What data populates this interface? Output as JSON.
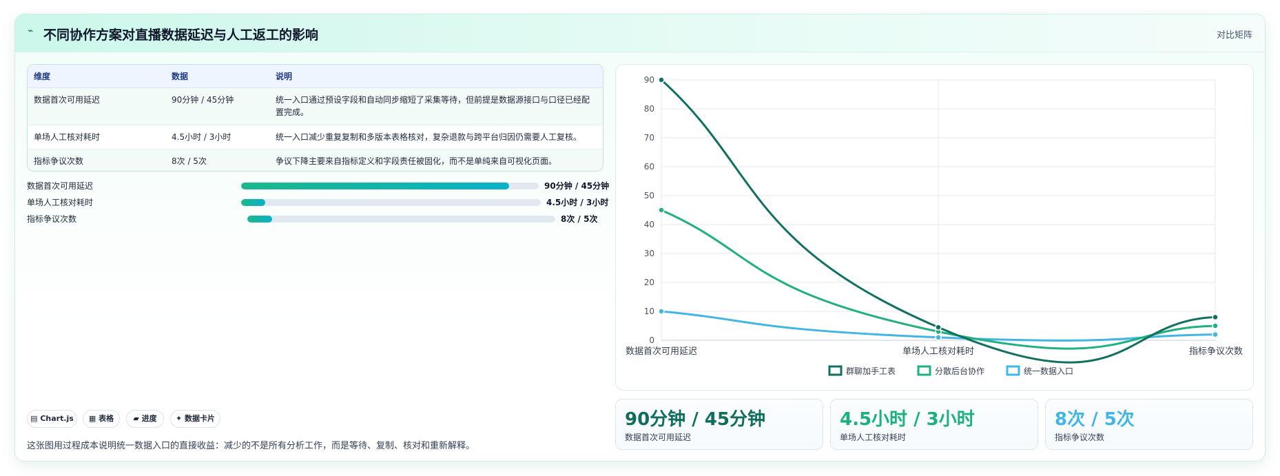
{
  "header": {
    "title": "不同协作方案对直播数据延迟与人工返工的影响",
    "view_tag": "对比矩阵",
    "icon": "sparkline-icon"
  },
  "table": {
    "columns": [
      "维度",
      "数据",
      "说明"
    ],
    "rows": [
      [
        "数据首次可用延迟",
        "90分钟 / 45分钟",
        "统一入口通过预设字段和自动同步缩短了采集等待，但前提是数据源接口与口径已经配置完成。"
      ],
      [
        "单场人工核对耗时",
        "4.5小时 / 3小时",
        "统一入口减少重复复制和多版本表格核对，复杂退款与跨平台归因仍需要人工复核。"
      ],
      [
        "指标争议次数",
        "8次 / 5次",
        "争议下降主要来自指标定义和字段责任被固化，而不是单纯来自可视化页面。"
      ]
    ]
  },
  "progress": [
    {
      "label": "数据首次可用延迟",
      "value_text": "90分钟 / 45分钟",
      "fraction": 0.9
    },
    {
      "label": "单场人工核对耗时",
      "value_text": "4.5小时 / 3小时",
      "fraction": 0.08
    },
    {
      "label": "指标争议次数",
      "value_text": "8次 / 5次",
      "fraction": 0.08
    }
  ],
  "chips": [
    "▤ Chart.js",
    "▦ 表格",
    "▰ 进度",
    "✦ 数据卡片"
  ],
  "summary": "这张图用过程成本说明统一数据入口的直接收益：减少的不是所有分析工作，而是等待、复制、核对和重新解释。",
  "stats": [
    {
      "value": "90分钟 / 45分钟",
      "label": "数据首次可用延迟",
      "color": "#0f6e5c"
    },
    {
      "value": "4.5小时 / 3小时",
      "label": "单场人工核对耗时",
      "color": "#1bb07d"
    },
    {
      "value": "8次 / 5次",
      "label": "指标争议次数",
      "color": "#41b6e6"
    }
  ],
  "chart_data": {
    "type": "line",
    "categories": [
      "数据首次可用延迟",
      "单场人工核对耗时",
      "指标争议次数"
    ],
    "series": [
      {
        "name": "群聊加手工表",
        "values": [
          90,
          4.5,
          8
        ],
        "color": "#11705f"
      },
      {
        "name": "分散后台协作",
        "values": [
          45,
          3,
          5
        ],
        "color": "#1eb17e"
      },
      {
        "name": "统一数据入口",
        "values": [
          10,
          1,
          2
        ],
        "color": "#41b6e6"
      }
    ],
    "ylim": [
      0,
      90
    ],
    "yticks": [
      0,
      10,
      20,
      30,
      40,
      50,
      60,
      70,
      80,
      90
    ],
    "grid": true,
    "legend": "bottom",
    "smooth": true
  }
}
